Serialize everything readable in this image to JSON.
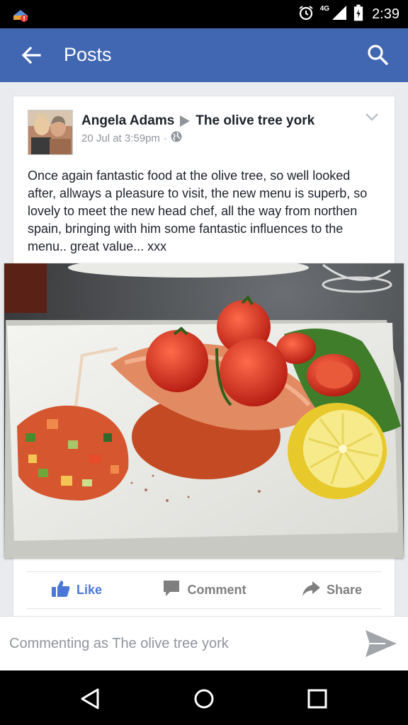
{
  "status_bar": {
    "time": "2:39",
    "network": "4G",
    "icons": [
      "app-notification-icon",
      "alarm-icon",
      "signal-icon",
      "battery-icon"
    ]
  },
  "app_bar": {
    "title": "Posts",
    "back_icon": "arrow-left-icon",
    "search_icon": "search-icon",
    "background": "#4267b2"
  },
  "post": {
    "author": "Angela Adams",
    "target_page": "The olive tree york",
    "timestamp": "20 Jul at 3:59pm",
    "separator": "·",
    "audience_icon": "globe-icon",
    "text": "Once again fantastic food at the olive tree, so well looked after, allways a pleasure to visit, the new menu is superb, so lovely to meet the new head chef, all the way from northen spain, bringing with him some fantastic influences to the menu.. great value... xxx"
  },
  "actions": {
    "like_label": "Like",
    "comment_label": "Comment",
    "share_label": "Share",
    "like_color": "#4b78d6",
    "inactive_color": "#7f7f7f"
  },
  "comment_bar": {
    "placeholder": "Commenting as The olive tree york",
    "send_icon": "send-icon"
  },
  "nav_bar": {
    "icons": [
      "nav-back-icon",
      "nav-home-icon",
      "nav-recents-icon"
    ]
  }
}
